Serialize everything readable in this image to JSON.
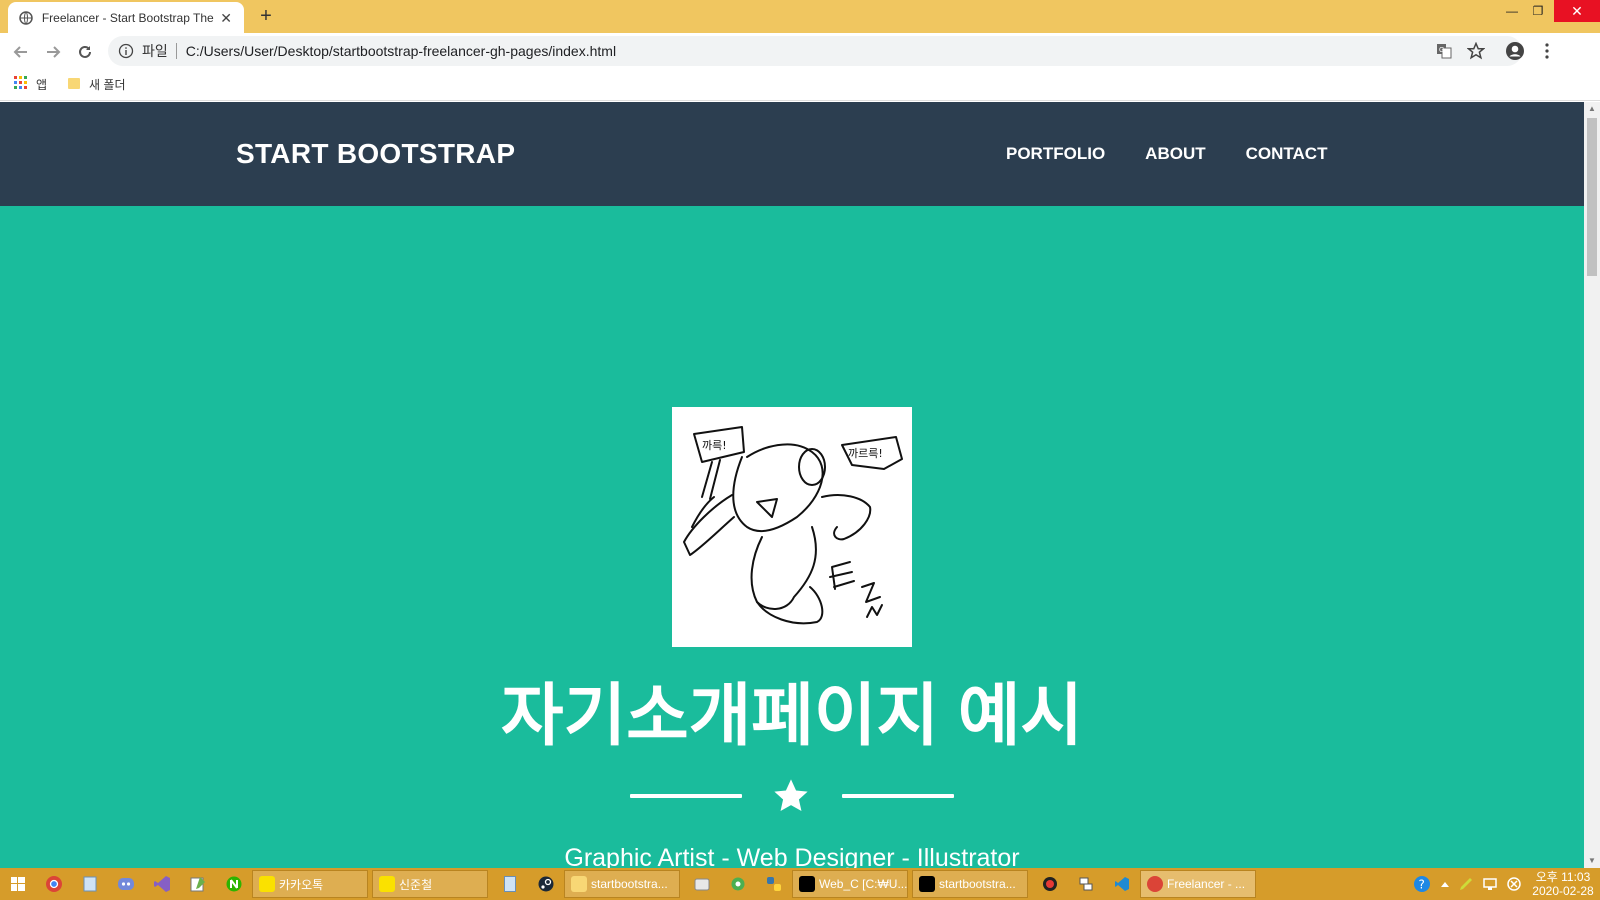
{
  "browser": {
    "tab_title": "Freelancer - Start Bootstrap The",
    "new_tab_label": "+",
    "scheme_label": "파일",
    "url": "C:/Users/User/Desktop/startbootstrap-freelancer-gh-pages/index.html",
    "bookmarks": [
      {
        "label": "앱",
        "icon": "apps-grid-icon"
      },
      {
        "label": "새 폴더",
        "icon": "folder-icon"
      }
    ]
  },
  "site": {
    "brand": "START BOOTSTRAP",
    "nav": [
      "PORTFOLIO",
      "ABOUT",
      "CONTACT"
    ],
    "hero_title": "자기소개페이지 예시",
    "hero_subtitle": "Graphic Artist - Web Designer - Illustrator",
    "avatar_speech_left": "까륵!",
    "avatar_speech_right": "까르륵!"
  },
  "taskbar": {
    "apps": [
      {
        "label": "카카오톡",
        "icon": "kakaotalk-icon"
      },
      {
        "label": "신준철",
        "icon": "kakaotalk-icon"
      },
      {
        "label": "startbootstra...",
        "icon": "folder-icon"
      },
      {
        "label": "Web_C [C:₩U...",
        "icon": "pycharm-icon"
      },
      {
        "label": "startbootstra...",
        "icon": "pycharm-icon"
      },
      {
        "label": "Freelancer - ...",
        "icon": "chrome-icon"
      }
    ],
    "clock_time": "오후 11:03",
    "clock_date": "2020-02-28"
  },
  "colors": {
    "nav_bg": "#2c3e50",
    "masthead_bg": "#1abc9c",
    "titlebar": "#f0c660",
    "taskbar": "#d69c2a"
  }
}
